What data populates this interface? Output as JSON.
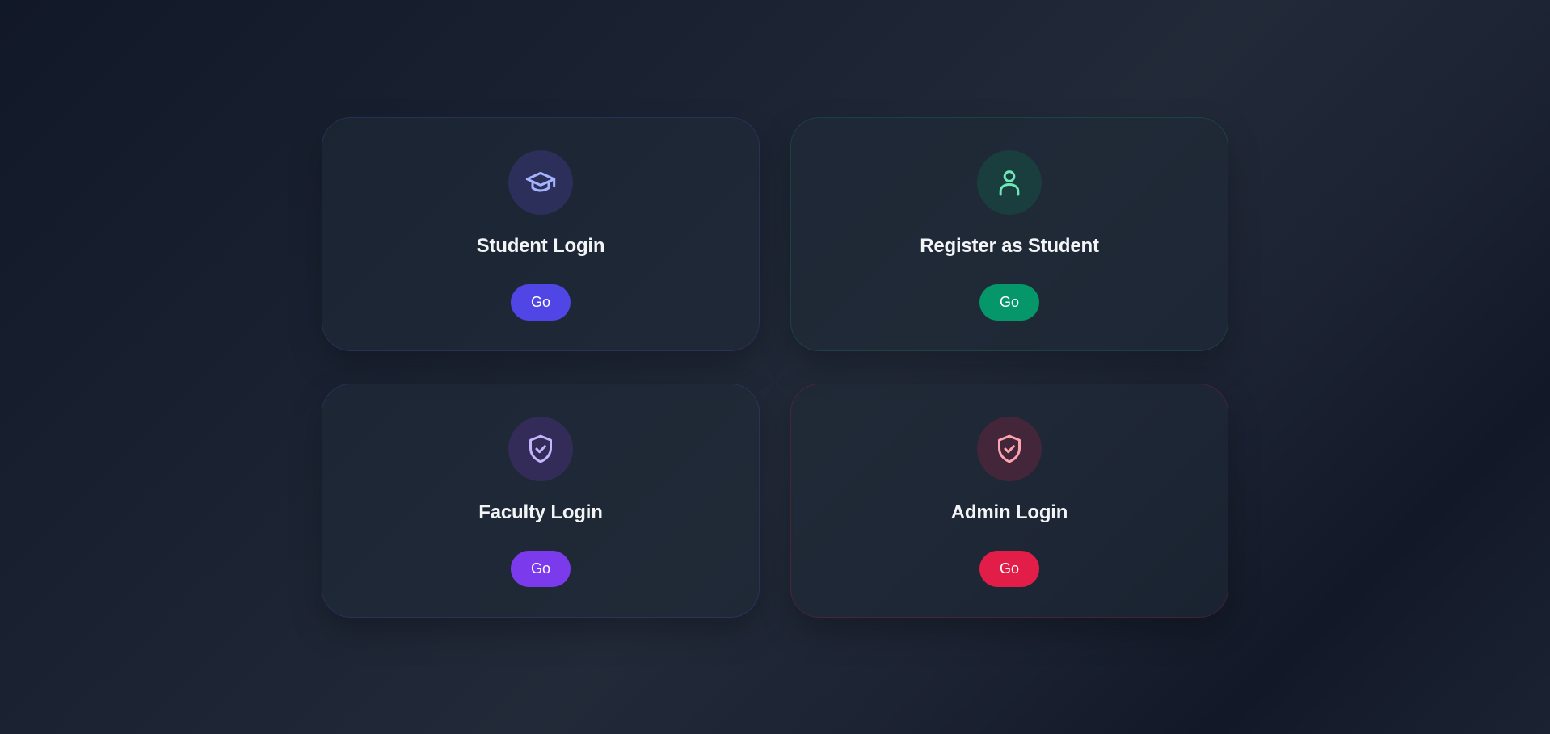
{
  "cards": [
    {
      "title": "Student Login",
      "button_label": "Go",
      "icon": "graduation-cap-icon",
      "accent": "#4f46e5",
      "icon_bg": "#2b2f5a",
      "icon_color": "#a5b4fc"
    },
    {
      "title": "Register as Student",
      "button_label": "Go",
      "icon": "user-icon",
      "accent": "#059669",
      "icon_bg": "#1a3d3d",
      "icon_color": "#6ee7b7"
    },
    {
      "title": "Faculty Login",
      "button_label": "Go",
      "icon": "shield-check-icon",
      "accent": "#7c3aed",
      "icon_bg": "#332c58",
      "icon_color": "#c4b5fd"
    },
    {
      "title": "Admin Login",
      "button_label": "Go",
      "icon": "shield-check-icon",
      "accent": "#e11d48",
      "icon_bg": "#43263a",
      "icon_color": "#fda4af"
    }
  ]
}
